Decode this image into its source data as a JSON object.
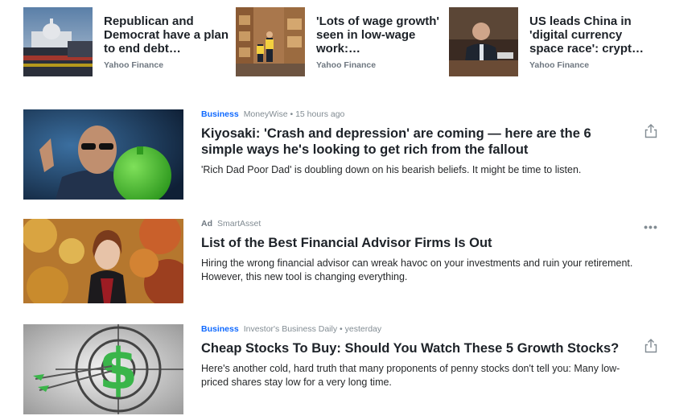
{
  "top_stories": [
    {
      "title": "Republican and Democrat have a plan to end debt…",
      "source": "Yahoo Finance",
      "image": "capitol-building-dusk"
    },
    {
      "title": "'Lots of wage growth' seen in low-wage work:…",
      "source": "Yahoo Finance",
      "image": "warehouse-workers"
    },
    {
      "title": "US leads China in 'digital currency space race': crypt…",
      "source": "Yahoo Finance",
      "image": "man-at-hearing"
    }
  ],
  "feed": [
    {
      "category": "Business",
      "publisher": "MoneyWise",
      "separator": "•",
      "time": "15 hours ago",
      "headline": "Kiyosaki: 'Crash and depression' are coming — here are the 6 simple ways he's looking to get rich from the fallout",
      "summary": "'Rich Dad Poor Dad' is doubling down on his bearish beliefs. It might be time to listen.",
      "action_icon": "share-icon"
    },
    {
      "ad_label": "Ad",
      "publisher": "SmartAsset",
      "headline": "List of the Best Financial Advisor Firms Is Out",
      "summary": "Hiring the wrong financial advisor can wreak havoc on your investments and ruin your retirement. However, this new tool is changing everything.",
      "action_icon": "more-options-icon",
      "action_glyph": "•••"
    },
    {
      "category": "Business",
      "publisher": "Investor's Business Daily",
      "separator": "•",
      "time": "yesterday",
      "headline": "Cheap Stocks To Buy: Should You Watch These 5 Growth Stocks?",
      "summary": "Here's another cold, hard truth that many proponents of penny stocks don't tell you: Many low-priced shares stay low for a very long time.",
      "action_icon": "share-icon"
    }
  ],
  "colors": {
    "category": "#0f69ff",
    "headline": "#1d2228",
    "meta": "#828c93"
  }
}
